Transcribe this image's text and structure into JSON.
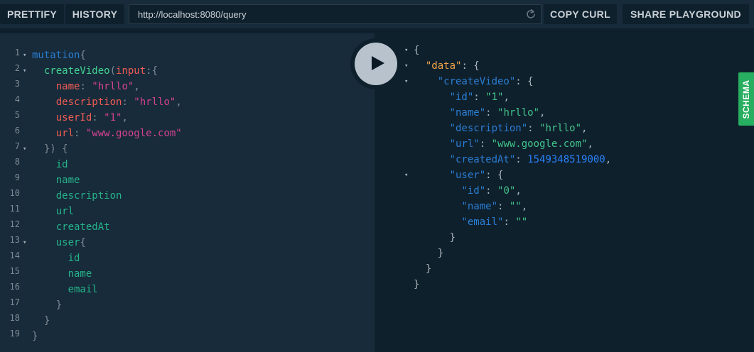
{
  "toolbar": {
    "prettify_label": "PRETTIFY",
    "history_label": "HISTORY",
    "url_value": "http://localhost:8080/query",
    "copy_curl_label": "COPY CURL",
    "share_label": "SHARE PLAYGROUND",
    "reload_icon": "reload-icon"
  },
  "editor": {
    "lines": [
      {
        "n": "1",
        "fold": true,
        "tokens": [
          [
            "kw",
            "mutation"
          ],
          [
            "punc",
            "{"
          ]
        ]
      },
      {
        "n": "2",
        "fold": true,
        "tokens": [
          [
            "sp",
            "  "
          ],
          [
            "fn",
            "createVideo"
          ],
          [
            "punc",
            "("
          ],
          [
            "arg",
            "input"
          ],
          [
            "punc",
            ":{"
          ]
        ]
      },
      {
        "n": "3",
        "fold": false,
        "tokens": [
          [
            "sp",
            "    "
          ],
          [
            "arg",
            "name"
          ],
          [
            "punc",
            ": "
          ],
          [
            "str",
            "\"hrllo\""
          ],
          [
            "punc",
            ","
          ]
        ]
      },
      {
        "n": "4",
        "fold": false,
        "tokens": [
          [
            "sp",
            "    "
          ],
          [
            "arg",
            "description"
          ],
          [
            "punc",
            ": "
          ],
          [
            "str",
            "\"hrllo\""
          ],
          [
            "punc",
            ","
          ]
        ]
      },
      {
        "n": "5",
        "fold": false,
        "tokens": [
          [
            "sp",
            "    "
          ],
          [
            "arg",
            "userId"
          ],
          [
            "punc",
            ": "
          ],
          [
            "str",
            "\"1\""
          ],
          [
            "punc",
            ","
          ]
        ]
      },
      {
        "n": "6",
        "fold": false,
        "tokens": [
          [
            "sp",
            "    "
          ],
          [
            "arg",
            "url"
          ],
          [
            "punc",
            ": "
          ],
          [
            "str",
            "\"www.google.com\""
          ]
        ]
      },
      {
        "n": "7",
        "fold": true,
        "tokens": [
          [
            "sp",
            "  "
          ],
          [
            "punc",
            "}) {"
          ]
        ]
      },
      {
        "n": "8",
        "fold": false,
        "tokens": [
          [
            "sp",
            "    "
          ],
          [
            "field",
            "id"
          ]
        ]
      },
      {
        "n": "9",
        "fold": false,
        "tokens": [
          [
            "sp",
            "    "
          ],
          [
            "field",
            "name"
          ]
        ]
      },
      {
        "n": "10",
        "fold": false,
        "tokens": [
          [
            "sp",
            "    "
          ],
          [
            "field",
            "description"
          ]
        ]
      },
      {
        "n": "11",
        "fold": false,
        "tokens": [
          [
            "sp",
            "    "
          ],
          [
            "field",
            "url"
          ]
        ]
      },
      {
        "n": "12",
        "fold": false,
        "tokens": [
          [
            "sp",
            "    "
          ],
          [
            "field",
            "createdAt"
          ]
        ]
      },
      {
        "n": "13",
        "fold": true,
        "tokens": [
          [
            "sp",
            "    "
          ],
          [
            "field",
            "user"
          ],
          [
            "punc",
            "{"
          ]
        ]
      },
      {
        "n": "14",
        "fold": false,
        "tokens": [
          [
            "sp",
            "      "
          ],
          [
            "field",
            "id"
          ]
        ]
      },
      {
        "n": "15",
        "fold": false,
        "tokens": [
          [
            "sp",
            "      "
          ],
          [
            "field",
            "name"
          ]
        ]
      },
      {
        "n": "16",
        "fold": false,
        "tokens": [
          [
            "sp",
            "      "
          ],
          [
            "field",
            "email"
          ]
        ]
      },
      {
        "n": "17",
        "fold": false,
        "tokens": [
          [
            "sp",
            "    "
          ],
          [
            "punc",
            "}"
          ]
        ]
      },
      {
        "n": "18",
        "fold": false,
        "tokens": [
          [
            "sp",
            "  "
          ],
          [
            "punc",
            "}"
          ]
        ]
      },
      {
        "n": "19",
        "fold": false,
        "tokens": [
          [
            "punc",
            "}"
          ]
        ]
      }
    ]
  },
  "result": {
    "lines": [
      {
        "fold": true,
        "tokens": [
          [
            "jpunc",
            "{"
          ]
        ]
      },
      {
        "fold": true,
        "tokens": [
          [
            "sp",
            "  "
          ],
          [
            "data",
            "\"data\""
          ],
          [
            "jpunc",
            ": {"
          ]
        ]
      },
      {
        "fold": true,
        "tokens": [
          [
            "sp",
            "    "
          ],
          [
            "key",
            "\"createVideo\""
          ],
          [
            "jpunc",
            ": {"
          ]
        ]
      },
      {
        "fold": false,
        "tokens": [
          [
            "sp",
            "      "
          ],
          [
            "key",
            "\"id\""
          ],
          [
            "jpunc",
            ": "
          ],
          [
            "jstr",
            "\"1\""
          ],
          [
            "jpunc",
            ","
          ]
        ]
      },
      {
        "fold": false,
        "tokens": [
          [
            "sp",
            "      "
          ],
          [
            "key",
            "\"name\""
          ],
          [
            "jpunc",
            ": "
          ],
          [
            "jstr",
            "\"hrllo\""
          ],
          [
            "jpunc",
            ","
          ]
        ]
      },
      {
        "fold": false,
        "tokens": [
          [
            "sp",
            "      "
          ],
          [
            "key",
            "\"description\""
          ],
          [
            "jpunc",
            ": "
          ],
          [
            "jstr",
            "\"hrllo\""
          ],
          [
            "jpunc",
            ","
          ]
        ]
      },
      {
        "fold": false,
        "tokens": [
          [
            "sp",
            "      "
          ],
          [
            "key",
            "\"url\""
          ],
          [
            "jpunc",
            ": "
          ],
          [
            "jstr",
            "\"www.google.com\""
          ],
          [
            "jpunc",
            ","
          ]
        ]
      },
      {
        "fold": false,
        "tokens": [
          [
            "sp",
            "      "
          ],
          [
            "key",
            "\"createdAt\""
          ],
          [
            "jpunc",
            ": "
          ],
          [
            "num",
            "1549348519000"
          ],
          [
            "jpunc",
            ","
          ]
        ]
      },
      {
        "fold": true,
        "tokens": [
          [
            "sp",
            "      "
          ],
          [
            "key",
            "\"user\""
          ],
          [
            "jpunc",
            ": {"
          ]
        ]
      },
      {
        "fold": false,
        "tokens": [
          [
            "sp",
            "        "
          ],
          [
            "key",
            "\"id\""
          ],
          [
            "jpunc",
            ": "
          ],
          [
            "jstr",
            "\"0\""
          ],
          [
            "jpunc",
            ","
          ]
        ]
      },
      {
        "fold": false,
        "tokens": [
          [
            "sp",
            "        "
          ],
          [
            "key",
            "\"name\""
          ],
          [
            "jpunc",
            ": "
          ],
          [
            "jstr",
            "\"\""
          ],
          [
            "jpunc",
            ","
          ]
        ]
      },
      {
        "fold": false,
        "tokens": [
          [
            "sp",
            "        "
          ],
          [
            "key",
            "\"email\""
          ],
          [
            "jpunc",
            ": "
          ],
          [
            "jstr",
            "\"\""
          ]
        ]
      },
      {
        "fold": false,
        "tokens": [
          [
            "sp",
            "      "
          ],
          [
            "jpunc",
            "}"
          ]
        ]
      },
      {
        "fold": false,
        "tokens": [
          [
            "sp",
            "    "
          ],
          [
            "jpunc",
            "}"
          ]
        ]
      },
      {
        "fold": false,
        "tokens": [
          [
            "sp",
            "  "
          ],
          [
            "jpunc",
            "}"
          ]
        ]
      },
      {
        "fold": false,
        "tokens": [
          [
            "jpunc",
            "}"
          ]
        ]
      }
    ]
  },
  "schema_tab": {
    "label": "SCHEMA"
  },
  "play": {
    "icon": "play-icon"
  },
  "colors": {
    "accent_green": "#27ae60",
    "panel_dark": "#172b3a",
    "panel_darker": "#0f202d"
  }
}
